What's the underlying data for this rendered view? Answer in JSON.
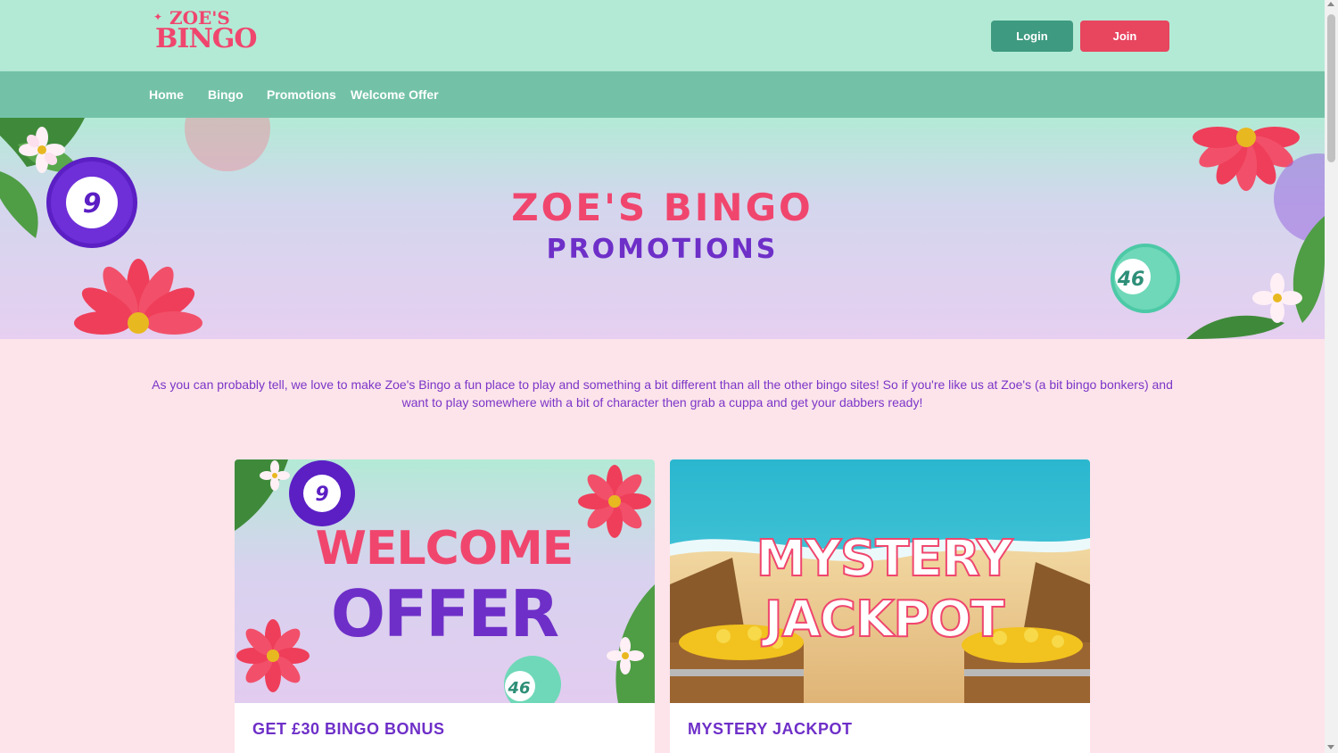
{
  "header": {
    "logo_top": "ZOE'S",
    "logo_bottom": "BINGO",
    "login_label": "Login",
    "join_label": "Join"
  },
  "nav": {
    "items": [
      {
        "label": "Home"
      },
      {
        "label": "Bingo"
      },
      {
        "label": "Promotions"
      },
      {
        "label": "Welcome Offer"
      }
    ]
  },
  "hero": {
    "title": "ZOE'S BINGO",
    "subtitle": "PROMOTIONS",
    "ball_left": "9",
    "ball_right": "46"
  },
  "intro": {
    "text": "As you can probably tell, we love to make Zoe's Bingo a fun place to play and something a bit different than all the other bingo sites! So if you're like us at Zoe's (a bit bingo bonkers) and want to play somewhere with a bit of character then grab a cuppa and get your dabbers ready!"
  },
  "cards": [
    {
      "image_line1": "WELCOME",
      "image_line2": "OFFER",
      "ball_a": "9",
      "ball_b": "46",
      "title": "GET £30 BINGO BONUS"
    },
    {
      "image_line1": "MYSTERY",
      "image_line2": "JACKPOT",
      "title": "MYSTERY JACKPOT"
    }
  ],
  "colors": {
    "brand_pink": "#f0466e",
    "brand_purple": "#6e2fc8",
    "header_mint": "#b3ead6",
    "nav_green": "#73c2a8",
    "login_green": "#3e9a80",
    "join_red": "#e8455f",
    "page_pink": "#fde4ea"
  }
}
